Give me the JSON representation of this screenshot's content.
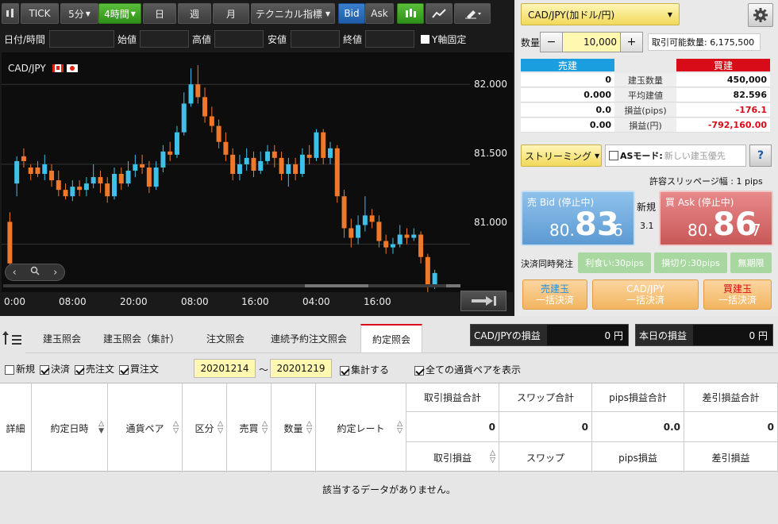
{
  "toolbar": {
    "tick": "TICK",
    "interval": "5分",
    "interval_active": "4時間",
    "day": "日",
    "week": "週",
    "month": "月",
    "indicator": "テクニカル指標",
    "bid": "Bid",
    "ask": "Ask"
  },
  "ohlc_bar": {
    "datetime_label": "日付/時間",
    "open_label": "始値",
    "high_label": "高値",
    "low_label": "安値",
    "close_label": "終値",
    "yaxis_fix_label": "Y軸固定"
  },
  "chart": {
    "symbol": "CAD/JPY",
    "y_ticks": [
      "82.000",
      "81.500",
      "81.000"
    ],
    "x_ticks": [
      "0:00",
      "08:00",
      "20:00",
      "08:00",
      "16:00",
      "04:00",
      "16:00"
    ]
  },
  "chart_data": {
    "type": "candlestick",
    "ylim": [
      80.7,
      82.2
    ],
    "series": [
      {
        "o": 81.14,
        "c": 80.88,
        "h": 81.2,
        "l": 80.85
      },
      {
        "o": 81.38,
        "c": 81.52,
        "h": 81.55,
        "l": 81.3
      },
      {
        "o": 81.55,
        "c": 81.52,
        "h": 81.6,
        "l": 81.48
      },
      {
        "o": 81.48,
        "c": 81.44,
        "h": 81.5,
        "l": 81.4
      },
      {
        "o": 81.48,
        "c": 81.44,
        "h": 81.52,
        "l": 81.42
      },
      {
        "o": 81.44,
        "c": 81.5,
        "h": 81.56,
        "l": 81.4
      },
      {
        "o": 81.46,
        "c": 81.4,
        "h": 81.5,
        "l": 81.36
      },
      {
        "o": 81.4,
        "c": 81.34,
        "h": 81.46,
        "l": 81.3
      },
      {
        "o": 81.34,
        "c": 81.3,
        "h": 81.38,
        "l": 81.28
      },
      {
        "o": 81.3,
        "c": 81.36,
        "h": 81.4,
        "l": 81.27
      },
      {
        "o": 81.36,
        "c": 81.34,
        "h": 81.4,
        "l": 81.3
      },
      {
        "o": 81.34,
        "c": 81.38,
        "h": 81.42,
        "l": 81.3
      },
      {
        "o": 81.38,
        "c": 81.42,
        "h": 81.5,
        "l": 81.35
      },
      {
        "o": 81.42,
        "c": 81.38,
        "h": 81.46,
        "l": 81.32
      },
      {
        "o": 81.38,
        "c": 81.3,
        "h": 81.42,
        "l": 81.26
      },
      {
        "o": 81.3,
        "c": 81.44,
        "h": 81.48,
        "l": 81.28
      },
      {
        "o": 81.44,
        "c": 81.38,
        "h": 81.48,
        "l": 81.34
      },
      {
        "o": 81.38,
        "c": 81.46,
        "h": 81.52,
        "l": 81.36
      },
      {
        "o": 81.46,
        "c": 81.5,
        "h": 81.56,
        "l": 81.42
      },
      {
        "o": 81.5,
        "c": 81.48,
        "h": 81.56,
        "l": 81.44
      },
      {
        "o": 81.48,
        "c": 81.36,
        "h": 81.52,
        "l": 81.32
      },
      {
        "o": 81.36,
        "c": 81.48,
        "h": 81.52,
        "l": 81.34
      },
      {
        "o": 81.48,
        "c": 81.58,
        "h": 81.62,
        "l": 81.45
      },
      {
        "o": 81.58,
        "c": 81.56,
        "h": 81.64,
        "l": 81.52
      },
      {
        "o": 81.56,
        "c": 81.7,
        "h": 81.74,
        "l": 81.54
      },
      {
        "o": 81.7,
        "c": 81.88,
        "h": 81.95,
        "l": 81.68
      },
      {
        "o": 81.88,
        "c": 82.0,
        "h": 82.1,
        "l": 81.86
      },
      {
        "o": 82.0,
        "c": 81.92,
        "h": 82.12,
        "l": 81.88
      },
      {
        "o": 81.92,
        "c": 81.8,
        "h": 81.98,
        "l": 81.76
      },
      {
        "o": 81.8,
        "c": 81.74,
        "h": 81.86,
        "l": 81.7
      },
      {
        "o": 81.74,
        "c": 81.64,
        "h": 81.78,
        "l": 81.6
      },
      {
        "o": 81.64,
        "c": 81.56,
        "h": 81.7,
        "l": 81.52
      },
      {
        "o": 81.56,
        "c": 81.44,
        "h": 81.6,
        "l": 81.4
      },
      {
        "o": 81.44,
        "c": 81.5,
        "h": 81.56,
        "l": 81.4
      },
      {
        "o": 81.5,
        "c": 81.54,
        "h": 81.6,
        "l": 81.46
      },
      {
        "o": 81.54,
        "c": 81.46,
        "h": 81.58,
        "l": 81.42
      },
      {
        "o": 81.46,
        "c": 81.52,
        "h": 81.58,
        "l": 81.44
      },
      {
        "o": 81.52,
        "c": 81.58,
        "h": 81.62,
        "l": 81.5
      },
      {
        "o": 81.58,
        "c": 81.54,
        "h": 81.62,
        "l": 81.48
      },
      {
        "o": 81.54,
        "c": 81.44,
        "h": 81.58,
        "l": 81.4
      },
      {
        "o": 81.44,
        "c": 81.5,
        "h": 81.54,
        "l": 81.36
      },
      {
        "o": 81.5,
        "c": 81.44,
        "h": 81.54,
        "l": 81.4
      },
      {
        "o": 81.44,
        "c": 81.56,
        "h": 81.6,
        "l": 81.42
      },
      {
        "o": 81.56,
        "c": 81.54,
        "h": 81.62,
        "l": 81.5
      },
      {
        "o": 81.54,
        "c": 81.7,
        "h": 81.72,
        "l": 81.52
      },
      {
        "o": 81.7,
        "c": 81.54,
        "h": 81.72,
        "l": 81.5
      },
      {
        "o": 81.54,
        "c": 81.6,
        "h": 81.64,
        "l": 81.5
      },
      {
        "o": 81.6,
        "c": 81.3,
        "h": 81.62,
        "l": 81.26
      },
      {
        "o": 81.3,
        "c": 81.1,
        "h": 81.34,
        "l": 81.04
      },
      {
        "o": 81.1,
        "c": 81.04,
        "h": 81.16,
        "l": 80.98
      },
      {
        "o": 81.04,
        "c": 81.12,
        "h": 81.18,
        "l": 81.0
      },
      {
        "o": 81.12,
        "c": 81.18,
        "h": 81.3,
        "l": 81.08
      },
      {
        "o": 81.18,
        "c": 81.14,
        "h": 81.22,
        "l": 81.1
      },
      {
        "o": 81.14,
        "c": 81.02,
        "h": 81.18,
        "l": 80.98
      },
      {
        "o": 81.02,
        "c": 80.98,
        "h": 81.06,
        "l": 80.94
      },
      {
        "o": 80.98,
        "c": 81.0,
        "h": 81.04,
        "l": 80.94
      },
      {
        "o": 81.0,
        "c": 81.06,
        "h": 81.12,
        "l": 80.98
      },
      {
        "o": 81.06,
        "c": 81.04,
        "h": 81.1,
        "l": 81.0
      },
      {
        "o": 81.04,
        "c": 81.06,
        "h": 81.1,
        "l": 81.02
      },
      {
        "o": 81.06,
        "c": 80.92,
        "h": 81.08,
        "l": 80.88
      },
      {
        "o": 80.92,
        "c": 80.74,
        "h": 80.94,
        "l": 80.7
      },
      {
        "o": 80.74,
        "c": 80.82,
        "h": 80.84,
        "l": 80.72
      }
    ]
  },
  "right": {
    "pair_select": "CAD/JPY(加ドル/円)",
    "qty_label": "数量",
    "qty_value": "10,000",
    "available": "取引可能数量: 6,175,500",
    "sell_header": "売建",
    "buy_header": "買建",
    "rows": [
      {
        "label": "建玉数量",
        "sell": "0",
        "buy": "450,000"
      },
      {
        "label": "平均建値",
        "sell": "0.000",
        "buy": "82.596"
      },
      {
        "label": "損益(pips)",
        "sell": "0.0",
        "buy": "-176.1"
      },
      {
        "label": "損益(円)",
        "sell": "0.00",
        "buy": "-792,160.00"
      }
    ],
    "streaming": "ストリーミング",
    "as_mode_label": "ASモード:",
    "as_mode_value": "新しい建玉優先",
    "help": "?",
    "slippage": "許容スリッページ幅 : 1 pips",
    "bid_title": "売 Bid (停止中)",
    "bid_prefix": "80.",
    "bid_big": "83",
    "bid_small": "6",
    "new_label": "新規",
    "spread": "3.1",
    "ask_title": "買 Ask (停止中)",
    "ask_prefix": "80.",
    "ask_big": "86",
    "ask_small": "7",
    "settle_label": "決済同時発注",
    "take_profit": "利食い:30pips",
    "stop_loss": "損切り:30pips",
    "unlimited": "無期限",
    "btn_sell_close_1": "売建玉",
    "btn_sell_close_2": "一括決済",
    "btn_pair_close_1": "CAD/JPY",
    "btn_pair_close_2": "一括決済",
    "btn_buy_close_1": "買建玉",
    "btn_buy_close_2": "一括決済"
  },
  "tabs": [
    "建玉照会",
    "建玉照会（集計）",
    "注文照会",
    "連続予約注文照会",
    "約定照会"
  ],
  "pl": {
    "pair_label": "CAD/JPYの損益",
    "pair_value": "0 円",
    "today_label": "本日の損益",
    "today_value": "0 円"
  },
  "filters": {
    "new": "新規",
    "settle": "決済",
    "sell_order": "売注文",
    "buy_order": "買注文",
    "date_from": "20201214",
    "tilde": "〜",
    "date_to": "20201219",
    "aggregate": "集計する",
    "all_pairs": "全ての通貨ペアを表示"
  },
  "table": {
    "headers": [
      "詳細",
      "約定日時",
      "通貨ペア",
      "区分",
      "売買",
      "数量",
      "約定レート"
    ],
    "sum_headers": [
      "取引損益合計",
      "スワップ合計",
      "pips損益合計",
      "差引損益合計"
    ],
    "sum_values": [
      "0",
      "0",
      "0.0",
      "0"
    ],
    "sub_headers": [
      "取引損益",
      "スワップ",
      "pips損益",
      "差引損益"
    ],
    "empty": "該当するデータがありません。"
  }
}
